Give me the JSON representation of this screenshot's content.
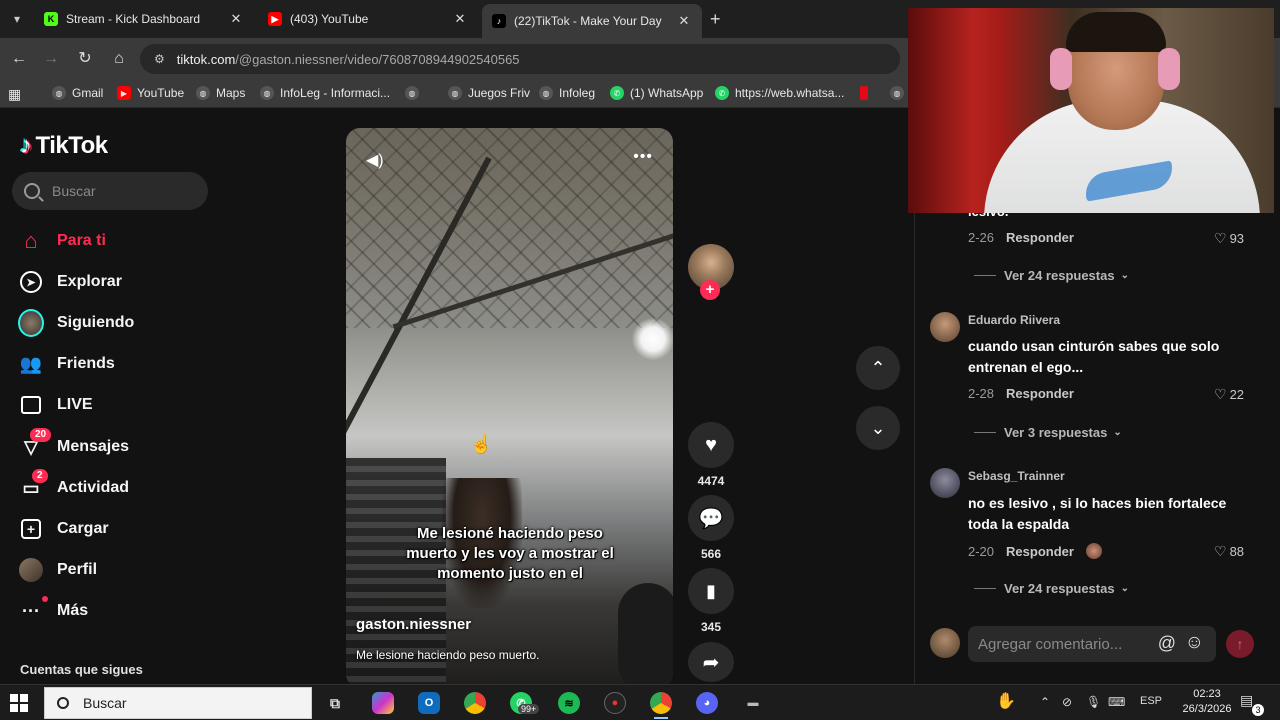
{
  "tabs": [
    {
      "title": "Stream - Kick Dashboard",
      "favicon": "kick-icon",
      "color": "#53fc18",
      "letter": "K"
    },
    {
      "title": "(403) YouTube",
      "favicon": "youtube-icon",
      "color": "#ff0000",
      "letter": "▶"
    },
    {
      "title": "(22)TikTok - Make Your Day",
      "favicon": "tiktok-icon",
      "color": "#000000",
      "letter": "♪"
    }
  ],
  "address": {
    "host": "tiktok.com",
    "path": "/@gaston.niessner/video/7608708944902540565"
  },
  "bookmarks": [
    {
      "label": "Gmail",
      "icon": "globe-icon"
    },
    {
      "label": "YouTube",
      "icon": "youtube-icon"
    },
    {
      "label": "Maps",
      "icon": "globe-icon"
    },
    {
      "label": "InfoLeg - Informaci...",
      "icon": "globe-icon"
    },
    {
      "label": "",
      "icon": "globe-icon"
    },
    {
      "label": "Juegos Friv",
      "icon": "globe-icon"
    },
    {
      "label": "Infoleg",
      "icon": "globe-icon"
    },
    {
      "label": "(1) WhatsApp",
      "icon": "whatsapp-icon"
    },
    {
      "label": "https://web.whatsa...",
      "icon": "whatsapp-icon"
    }
  ],
  "brand": {
    "name": "TikTok",
    "accent": "#fe2c55"
  },
  "search": {
    "placeholder": "Buscar"
  },
  "nav": [
    {
      "label": "Para ti",
      "icon": "home-icon",
      "active": true
    },
    {
      "label": "Explorar",
      "icon": "compass-icon"
    },
    {
      "label": "Siguiendo",
      "icon": "following-avatar-icon"
    },
    {
      "label": "Friends",
      "icon": "friends-icon"
    },
    {
      "label": "LIVE",
      "icon": "live-icon"
    },
    {
      "label": "Mensajes",
      "icon": "messages-icon",
      "badge": "20"
    },
    {
      "label": "Actividad",
      "icon": "activity-icon",
      "badge": "2"
    },
    {
      "label": "Cargar",
      "icon": "upload-icon"
    },
    {
      "label": "Perfil",
      "icon": "profile-avatar-icon"
    },
    {
      "label": "Más",
      "icon": "more-dots-icon"
    }
  ],
  "following_header": "Cuentas que sigues",
  "video": {
    "caption": "Me lesioné haciendo peso muerto y les voy a mostrar el momento justo en el",
    "username": "gaston.niessner",
    "description": "Me lesione haciendo peso muerto."
  },
  "actions": {
    "likes": "4474",
    "comments": "566",
    "saves": "345"
  },
  "comments": {
    "top_meta": {
      "date": "2-26",
      "reply": "Responder",
      "likes": "93"
    },
    "top_more": "Ver 24 respuestas",
    "items": [
      {
        "name": "Eduardo Riivera",
        "text": "cuando usan cinturón sabes que solo entrenan el ego...",
        "date": "2-28",
        "reply": "Responder",
        "likes": "22",
        "more": "Ver 3 respuestas"
      },
      {
        "name": "Sebasg_Trainner",
        "text": "no es lesivo , si lo haces bien fortalece toda la espalda",
        "date": "2-20",
        "reply": "Responder",
        "likes": "88",
        "more": "Ver 24 respuestas"
      }
    ],
    "input_placeholder": "Agregar comentario...",
    "partial_text": "lesivo."
  },
  "taskbar": {
    "search": "Buscar",
    "lang": "ESP",
    "time": "02:23",
    "date": "26/3/2026",
    "notif": "3",
    "badge_whatsapp": "99+"
  }
}
